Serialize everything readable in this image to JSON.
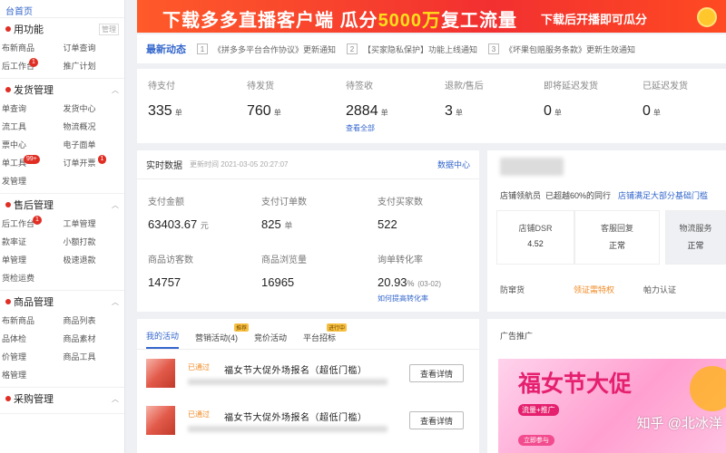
{
  "sidebar": {
    "top_label": "台首页",
    "sections": [
      {
        "title": "用功能",
        "manage": "管理",
        "items": [
          {
            "label": "布新商品"
          },
          {
            "label": "订单查询"
          },
          {
            "label": "后工作台",
            "badge": "1"
          },
          {
            "label": "推广计划"
          }
        ]
      },
      {
        "title": "发货管理",
        "items": [
          {
            "label": "单查询"
          },
          {
            "label": "发货中心"
          },
          {
            "label": "流工具"
          },
          {
            "label": "物流概况"
          },
          {
            "label": "票中心"
          },
          {
            "label": "电子面单"
          },
          {
            "label": "单工具",
            "badge": "99+"
          },
          {
            "label": "订单开票",
            "badge": "1"
          },
          {
            "label": "发管理"
          }
        ]
      },
      {
        "title": "售后管理",
        "items": [
          {
            "label": "后工作台",
            "badge": "1"
          },
          {
            "label": "工单管理"
          },
          {
            "label": "款率证"
          },
          {
            "label": "小额打款"
          },
          {
            "label": "单管理"
          },
          {
            "label": "极速退款"
          },
          {
            "label": "货检运费"
          }
        ]
      },
      {
        "title": "商品管理",
        "items": [
          {
            "label": "布新商品"
          },
          {
            "label": "商品列表"
          },
          {
            "label": "品体检"
          },
          {
            "label": "商品素材"
          },
          {
            "label": "价管理"
          },
          {
            "label": "商品工具"
          },
          {
            "label": "格管理"
          }
        ]
      },
      {
        "title": "采购管理",
        "items": []
      }
    ]
  },
  "banner": {
    "left_part1": "下载多多直播客户端",
    "left_part2": "瓜分",
    "highlight": "5000万",
    "left_part3": "复工流量",
    "right": "下载后开播即可瓜分"
  },
  "news": {
    "title": "最新动态",
    "items": [
      {
        "num": "1",
        "text": "《拼多多平台合作协议》更新通知"
      },
      {
        "num": "2",
        "text": "【买家隐私保护】功能上线通知"
      },
      {
        "num": "3",
        "text": "《坏果包赔服务条款》更新生效通知"
      }
    ]
  },
  "order_stats": [
    {
      "label": "待支付",
      "value": "335",
      "unit": "单"
    },
    {
      "label": "待发货",
      "value": "760",
      "unit": "单"
    },
    {
      "label": "待签收",
      "value": "2884",
      "unit": "单",
      "link": "查看全部"
    },
    {
      "label": "退款/售后",
      "value": "3",
      "unit": "单"
    },
    {
      "label": "即将延迟发货",
      "value": "0",
      "unit": "单"
    },
    {
      "label": "已延迟发货",
      "value": "0",
      "unit": "单"
    }
  ],
  "realtime": {
    "title": "实时数据",
    "time": "更新时间 2021-03-05 20:27:07",
    "center_link": "数据中心",
    "metrics": [
      {
        "label": "支付金额",
        "value": "63403.67",
        "unit": "元"
      },
      {
        "label": "支付订单数",
        "value": "825",
        "unit": "单"
      },
      {
        "label": "支付买家数",
        "value": "522",
        "unit": ""
      },
      {
        "label": "商品访客数",
        "value": "14757",
        "unit": ""
      },
      {
        "label": "商品浏览量",
        "value": "16965",
        "unit": ""
      },
      {
        "label": "询单转化率",
        "value": "20.93",
        "unit": "%",
        "date": "(03-02)",
        "link": "如何提高转化率"
      }
    ]
  },
  "shop": {
    "level_text": "店铺领航员",
    "level_desc": "已超越60%的同行",
    "level_link": "店铺满足大部分基础门槛",
    "boxes": [
      {
        "label": "店铺DSR",
        "value": "4.52"
      },
      {
        "label": "客服回复",
        "value": "正常"
      },
      {
        "label": "物流服务",
        "value": "正常"
      }
    ],
    "row_label": "防窜货",
    "row_link": "领证需特权",
    "row_right": "帕力认证"
  },
  "activities": {
    "tabs": [
      {
        "label": "我的活动",
        "active": true
      },
      {
        "label": "营销活动(4)",
        "tag": "推荐"
      },
      {
        "label": "竞价活动"
      },
      {
        "label": "平台招标",
        "tag": "进行中"
      }
    ],
    "items": [
      {
        "status": "已通过",
        "name": "福女节大促外场报名（超低门槛）",
        "button": "查看详情"
      },
      {
        "status": "已通过",
        "name": "福女节大促外场报名（超低门槛）",
        "button": "查看详情"
      }
    ]
  },
  "ad": {
    "title": "广告推广",
    "image_title": "福女节大促",
    "image_sub": "流量+推广",
    "image_go": "立即参与",
    "watermark": "知乎 @北冰洋"
  }
}
